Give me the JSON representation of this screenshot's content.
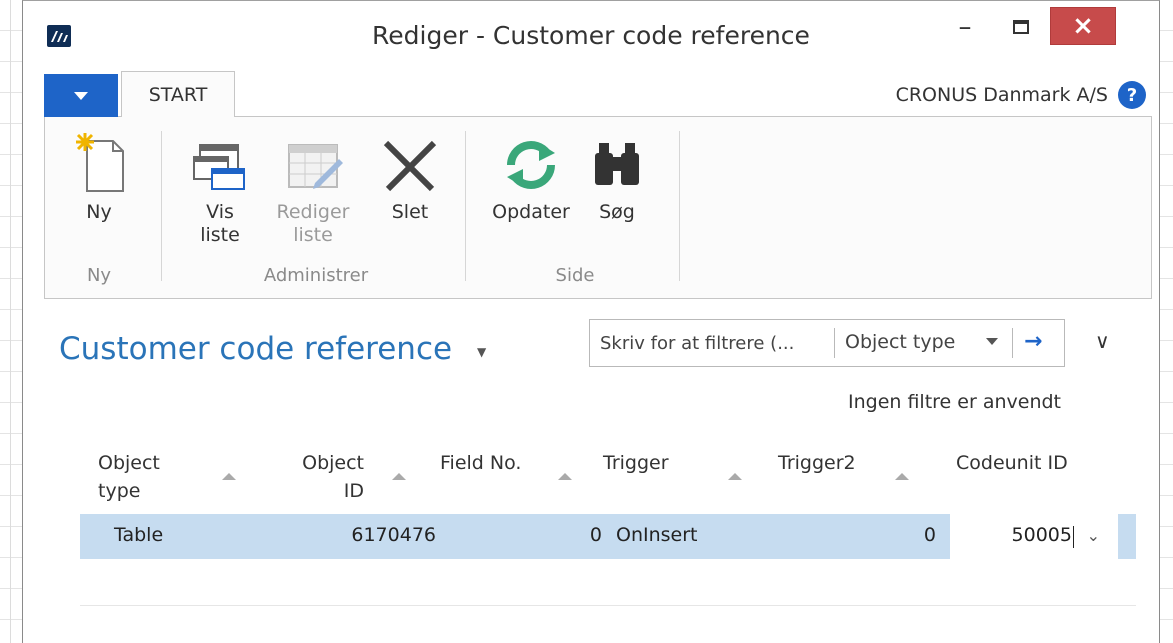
{
  "window": {
    "title": "Rediger - Customer code reference",
    "minimize": "–",
    "close": "×"
  },
  "ribbon": {
    "tab_start": "START",
    "company": "CRONUS Danmark A/S",
    "help": "?",
    "buttons": {
      "ny": "Ny",
      "vis_liste_1": "Vis",
      "vis_liste_2": "liste",
      "rediger_liste_1": "Rediger",
      "rediger_liste_2": "liste",
      "slet": "Slet",
      "opdater": "Opdater",
      "sog": "Søg"
    },
    "groups": {
      "ny": "Ny",
      "administrer": "Administrer",
      "side": "Side"
    }
  },
  "page": {
    "title": "Customer code reference",
    "title_caret": "▼",
    "filter_placeholder": "Skriv for at filtrere (...",
    "filter_field": "Object type",
    "filter_go": "→",
    "collapse": "∨",
    "no_filters": "Ingen filtre er anvendt"
  },
  "table": {
    "headers": {
      "object_type_1": "Object",
      "object_type_2": "type",
      "object_id_1": "Object",
      "object_id_2": "ID",
      "field_no": "Field No.",
      "trigger": "Trigger",
      "trigger2": "Trigger2",
      "codeunit_id": "Codeunit ID"
    },
    "rows": [
      {
        "object_type": "Table",
        "object_id": "6170476",
        "field_no": "0",
        "trigger": "OnInsert",
        "trigger2": "0",
        "codeunit_id": "50005"
      }
    ],
    "dropdown_glyph": "⌄"
  },
  "colors": {
    "accent": "#1e64c8",
    "title_blue": "#2a74b8",
    "selected_row": "#c6dcf0",
    "close_red": "#c74b4b"
  }
}
